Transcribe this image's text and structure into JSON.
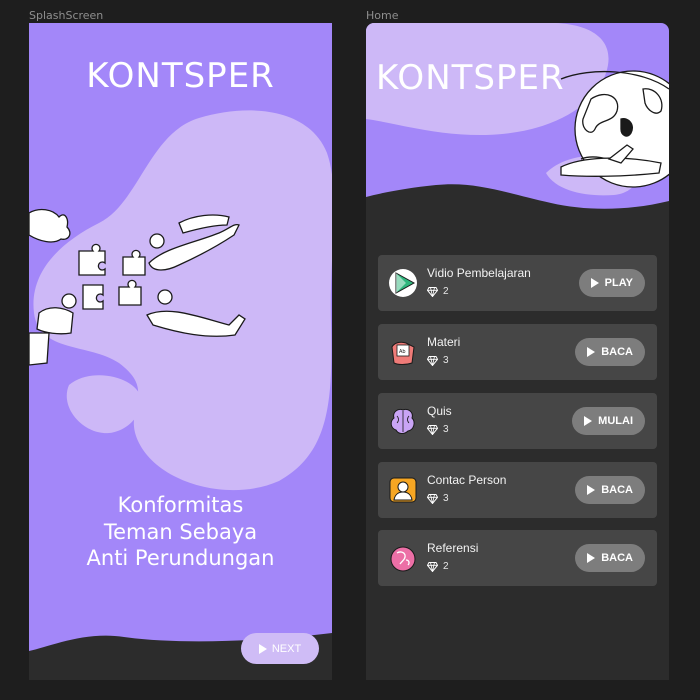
{
  "frames": {
    "splash_label": "SplashScreen",
    "home_label": "Home"
  },
  "splash": {
    "title": "KONTSPER",
    "tagline_lines": [
      "Konformitas",
      "Teman Sebaya",
      "Anti Perundungan"
    ],
    "next_label": "NEXT"
  },
  "home": {
    "title": "KONTSPER",
    "items": [
      {
        "title": "Vidio Pembelajaran",
        "count": "2",
        "action": "PLAY",
        "icon": "video-play-icon"
      },
      {
        "title": "Materi",
        "count": "3",
        "action": "BACA",
        "icon": "book-icon"
      },
      {
        "title": "Quis",
        "count": "3",
        "action": "MULAI",
        "icon": "brain-icon"
      },
      {
        "title": "Contac Person",
        "count": "3",
        "action": "BACA",
        "icon": "person-icon"
      },
      {
        "title": "Referensi",
        "count": "2",
        "action": "BACA",
        "icon": "reference-icon"
      }
    ]
  },
  "colors": {
    "accent": "#a387f9",
    "accent_light": "#cdb8f7",
    "card": "#464646",
    "background": "#1e1e1e"
  }
}
